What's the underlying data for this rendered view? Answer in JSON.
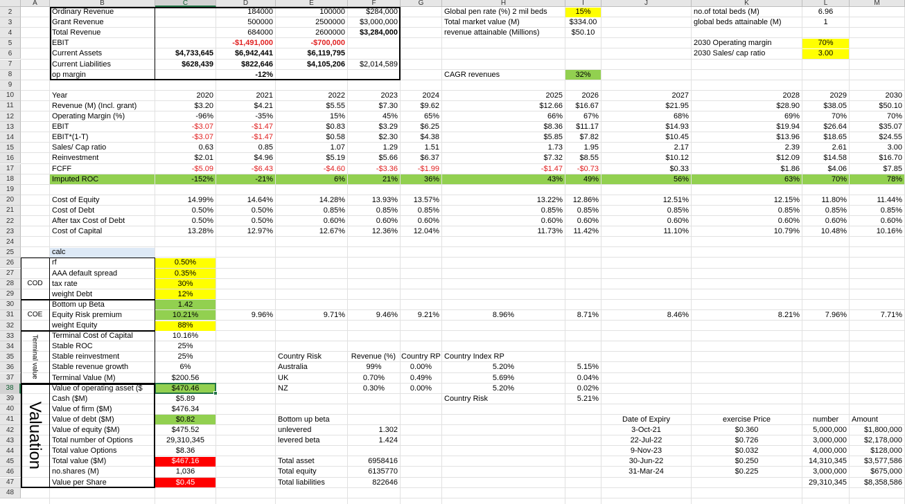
{
  "columns": [
    "A",
    "B",
    "C",
    "D",
    "E",
    "F",
    "G",
    "H",
    "I",
    "J",
    "K",
    "L",
    "M"
  ],
  "rows": [
    2,
    3,
    4,
    5,
    6,
    7,
    8,
    9,
    10,
    11,
    12,
    13,
    14,
    15,
    16,
    17,
    18,
    19,
    20,
    21,
    22,
    23,
    24,
    25,
    26,
    27,
    28,
    29,
    30,
    31,
    32,
    33,
    34,
    35,
    36,
    37,
    38,
    39,
    40,
    41,
    42,
    43,
    44,
    45,
    46,
    47,
    48
  ],
  "selected": {
    "column": "C",
    "row": 38
  },
  "side_labels": {
    "cod": "COD",
    "coe": "COE",
    "terminal": "Terminal value",
    "valuation": "Valuation"
  },
  "top": {
    "labels": [
      "Ordinary Revenue",
      "Grant Revenue",
      "Total Revenue",
      "EBIT",
      "Current Assets",
      "Current Liabilities",
      "op margin"
    ],
    "C": [
      "",
      "",
      "",
      "",
      "$4,733,645",
      "$628,439",
      ""
    ],
    "D": [
      "184000",
      "500000",
      "684000",
      "-$1,491,000",
      "$6,942,441",
      "$822,646",
      "-12%"
    ],
    "E": [
      "100000",
      "2500000",
      "2600000",
      "-$700,000",
      "$6,119,795",
      "$4,105,206",
      ""
    ],
    "F": [
      "$284,000",
      "$3,000,000",
      "$3,284,000",
      "",
      "",
      "$2,014,589",
      ""
    ],
    "H": [
      "Global pen rate (%) 2 mil beds",
      "Total market value (M)",
      "revenue attainable (Millions)",
      "",
      "",
      "",
      "CAGR revenues"
    ],
    "I": [
      "15%",
      "$334.00",
      "$50.10",
      "",
      "",
      "",
      "32%"
    ],
    "K": [
      "no.of total beds (M)",
      "global beds attainable (M)",
      "",
      "2030 Operating margin",
      "2030 Sales/ cap ratio",
      "",
      ""
    ],
    "L": [
      "6.96",
      "1",
      "",
      "70%",
      "3.00",
      "",
      ""
    ]
  },
  "years": {
    "header": "Year",
    "cols": [
      "2020",
      "2021",
      "2022",
      "2023",
      "2024",
      "2025",
      "2026",
      "2027",
      "2028",
      "2029",
      "2030"
    ],
    "rows": [
      {
        "label": "Revenue (M) (Incl. grant)",
        "values": [
          "$3.20",
          "$4.21",
          "$5.55",
          "$7.30",
          "$9.62",
          "$12.66",
          "$16.67",
          "$21.95",
          "$28.90",
          "$38.05",
          "$50.10"
        ]
      },
      {
        "label": "Operating Margin (%)",
        "values": [
          "-96%",
          "-35%",
          "15%",
          "45%",
          "65%",
          "66%",
          "67%",
          "68%",
          "69%",
          "70%",
          "70%"
        ]
      },
      {
        "label": "EBIT",
        "values": [
          "-$3.07",
          "-$1.47",
          "$0.83",
          "$3.29",
          "$6.25",
          "$8.36",
          "$11.17",
          "$14.93",
          "$19.94",
          "$26.64",
          "$35.07"
        ]
      },
      {
        "label": "EBIT*(1-T)",
        "values": [
          "-$3.07",
          "-$1.47",
          "$0.58",
          "$2.30",
          "$4.38",
          "$5.85",
          "$7.82",
          "$10.45",
          "$13.96",
          "$18.65",
          "$24.55"
        ]
      },
      {
        "label": "Sales/ Cap ratio",
        "values": [
          "0.63",
          "0.85",
          "1.07",
          "1.29",
          "1.51",
          "1.73",
          "1.95",
          "2.17",
          "2.39",
          "2.61",
          "3.00"
        ]
      },
      {
        "label": "Reinvestment",
        "values": [
          "$2.01",
          "$4.96",
          "$5.19",
          "$5.66",
          "$6.37",
          "$7.32",
          "$8.55",
          "$10.12",
          "$12.09",
          "$14.58",
          "$16.70"
        ]
      },
      {
        "label": "FCFF",
        "values": [
          "-$5.09",
          "-$6.43",
          "-$4.60",
          "-$3.36",
          "-$1.99",
          "-$1.47",
          "-$0.73",
          "$0.33",
          "$1.86",
          "$4.06",
          "$7.85"
        ]
      },
      {
        "label": "Imputed ROC",
        "values": [
          "-152%",
          "-21%",
          "6%",
          "21%",
          "36%",
          "43%",
          "49%",
          "56%",
          "63%",
          "70%",
          "78%"
        ]
      }
    ],
    "cost_rows": [
      {
        "label": "Cost of Equity",
        "values": [
          "14.99%",
          "14.64%",
          "14.28%",
          "13.93%",
          "13.57%",
          "13.22%",
          "12.86%",
          "12.51%",
          "12.15%",
          "11.80%",
          "11.44%"
        ]
      },
      {
        "label": "Cost of Debt",
        "values": [
          "0.50%",
          "0.50%",
          "0.85%",
          "0.85%",
          "0.85%",
          "0.85%",
          "0.85%",
          "0.85%",
          "0.85%",
          "0.85%",
          "0.85%"
        ]
      },
      {
        "label": "After tax Cost of Debt",
        "values": [
          "0.50%",
          "0.50%",
          "0.60%",
          "0.60%",
          "0.60%",
          "0.60%",
          "0.60%",
          "0.60%",
          "0.60%",
          "0.60%",
          "0.60%"
        ]
      },
      {
        "label": "Cost of Capital",
        "values": [
          "13.28%",
          "12.97%",
          "12.67%",
          "12.36%",
          "12.04%",
          "11.73%",
          "11.42%",
          "11.10%",
          "10.79%",
          "10.48%",
          "10.16%"
        ]
      }
    ]
  },
  "calc": {
    "title": "calc",
    "items": [
      {
        "label": "rf",
        "value": "0.50%"
      },
      {
        "label": "AAA default spread",
        "value": "0.35%"
      },
      {
        "label": "tax rate",
        "value": "30%"
      },
      {
        "label": "weight Debt",
        "value": "12%"
      },
      {
        "label": "Bottom up Beta",
        "value": "1.42"
      },
      {
        "label": "Equity Risk premium",
        "value": "10.21%"
      },
      {
        "label": "weight Equity",
        "value": "88%"
      },
      {
        "label": "Terminal Cost of Capital",
        "value": "10.16%"
      },
      {
        "label": "Stable ROC",
        "value": "25%"
      },
      {
        "label": "Stable reinvestment",
        "value": "25%"
      },
      {
        "label": "Stable revenue growth",
        "value": "6%"
      },
      {
        "label": "Terminal Value (M)",
        "value": "$200.56"
      },
      {
        "label": "Value of operating asset ($",
        "value": "$470.46"
      },
      {
        "label": "Cash ($M)",
        "value": "$5.89"
      },
      {
        "label": "Value of firm ($M)",
        "value": "$476.34"
      },
      {
        "label": "Value of debt ($M)",
        "value": "$0.82"
      },
      {
        "label": "Value of equity ($M)",
        "value": "$475.52"
      },
      {
        "label": "Total number of Options",
        "value": "29,310,345"
      },
      {
        "label": "Total value Options",
        "value": "$8.36"
      },
      {
        "label": "Total value ($M)",
        "value": "$467.16"
      },
      {
        "label": "no.shares (M)",
        "value": "1,036"
      },
      {
        "label": "Value per Share",
        "value": "$0.45"
      }
    ],
    "erp_row": [
      "9.96%",
      "9.71%",
      "9.46%",
      "9.21%",
      "8.96%",
      "8.71%",
      "8.46%",
      "8.21%",
      "7.96%",
      "7.71%"
    ]
  },
  "country": {
    "headers": [
      "Country Risk",
      "Revenue (%)",
      "Country RP",
      "Country Index RP"
    ],
    "rows": [
      {
        "country": "Australia",
        "rev": "99%",
        "rp": "0.00%",
        "idx": "5.20%",
        "i": "5.15%"
      },
      {
        "country": "UK",
        "rev": "0.70%",
        "rp": "0.49%",
        "idx": "5.69%",
        "i": "0.04%"
      },
      {
        "country": "NZ",
        "rev": "0.30%",
        "rp": "0.00%",
        "idx": "5.20%",
        "i": "0.02%"
      }
    ],
    "footer_label": "Country Risk",
    "footer_value": "5.21%"
  },
  "beta": {
    "title": "Bottom up beta",
    "rows": [
      {
        "label": "unlevered",
        "value": "1.302"
      },
      {
        "label": "levered beta",
        "value": "1.424"
      }
    ]
  },
  "totals": [
    {
      "label": "Total asset",
      "value": "6958416"
    },
    {
      "label": "Total equity",
      "value": "6135770"
    },
    {
      "label": "Total liabilities",
      "value": "822646"
    }
  ],
  "options": {
    "headers": [
      "Date of Expiry",
      "exercise Price",
      "number",
      "Amount"
    ],
    "rows": [
      [
        "3-Oct-21",
        "$0.360",
        "5,000,000",
        "$1,800,000"
      ],
      [
        "22-Jul-22",
        "$0.726",
        "3,000,000",
        "$2,178,000"
      ],
      [
        "9-Nov-23",
        "$0.032",
        "4,000,000",
        "$128,000"
      ],
      [
        "30-Jun-22",
        "$0.250",
        "14,310,345",
        "$3,577,586"
      ],
      [
        "31-Mar-24",
        "$0.225",
        "3,000,000",
        "$675,000"
      ]
    ],
    "total_number": "29,310,345",
    "total_amount": "$8,358,586"
  }
}
